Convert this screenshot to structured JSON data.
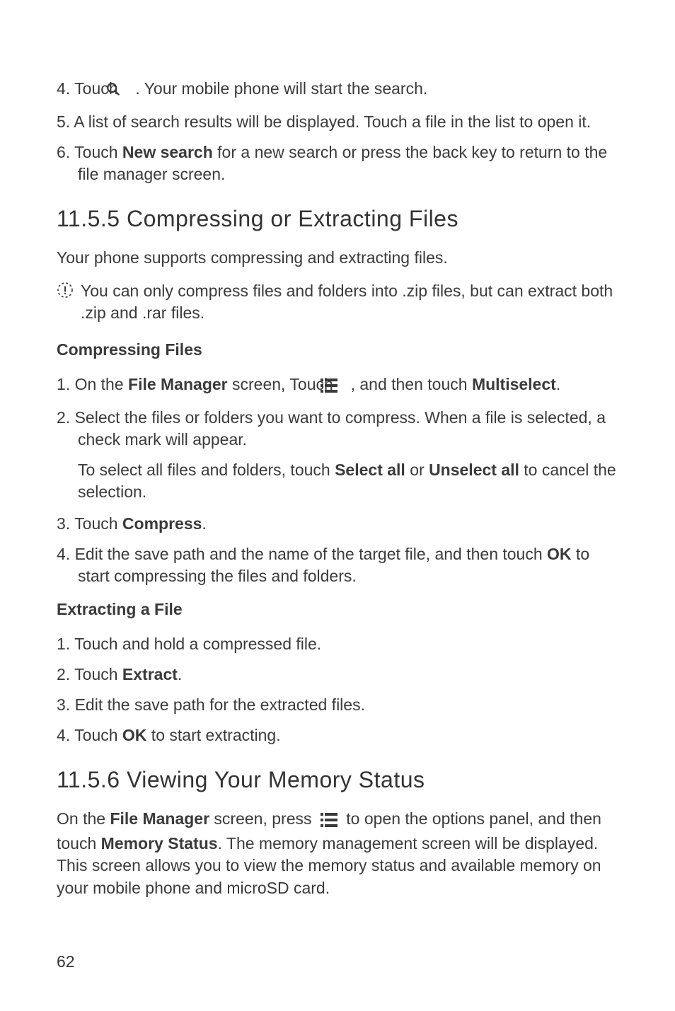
{
  "steps_top": {
    "s4_a": "4. Touch ",
    "s4_b": " . Your mobile phone will start the search.",
    "s5": "5. A list of search results will be displayed. Touch a file in the list to open it.",
    "s6_a": "6. Touch ",
    "s6_bold": "New search",
    "s6_b": " for a new search or press the back key to return to the file manager screen."
  },
  "section1": {
    "heading": "11.5.5  Compressing or Extracting Files",
    "intro": "Your phone supports compressing and extracting files.",
    "note": "You can only compress files and folders into .zip files, but can extract both .zip and .rar files."
  },
  "compressing": {
    "heading": "Compressing Files",
    "s1_a": "1. On the ",
    "s1_bold1": "File Manager",
    "s1_b": " screen, Touch ",
    "s1_c": " , and then touch ",
    "s1_bold2": "Multiselect",
    "s1_d": ".",
    "s2": "2. Select the files or folders you want to compress. When a file is selected, a check mark will appear.",
    "s2_tip_a": "To select all files and folders, touch ",
    "s2_tip_bold1": "Select all",
    "s2_tip_b": " or ",
    "s2_tip_bold2": "Unselect all",
    "s2_tip_c": " to cancel the selection.",
    "s3_a": "3. Touch ",
    "s3_bold": "Compress",
    "s3_b": ".",
    "s4_a": "4. Edit the save path and the name of the target file, and then touch ",
    "s4_bold": "OK",
    "s4_b": " to start compressing the files and folders."
  },
  "extracting": {
    "heading": "Extracting a File",
    "s1": "1. Touch and hold a compressed file.",
    "s2_a": "2. Touch ",
    "s2_bold": "Extract",
    "s2_b": ".",
    "s3": "3. Edit the save path for the extracted files.",
    "s4_a": "4. Touch ",
    "s4_bold": "OK",
    "s4_b": " to start extracting."
  },
  "section2": {
    "heading": "11.5.6  Viewing Your Memory Status",
    "p_a": "On the ",
    "p_bold1": "File Manager",
    "p_b": " screen, press ",
    "p_c": " to open the options panel, and then touch ",
    "p_bold2": "Memory Status",
    "p_d": ". The memory management screen will be displayed. This screen allows you to view the memory status and available memory on your mobile phone and microSD card."
  },
  "page_number": "62",
  "icons": {
    "search": "search-icon",
    "menu": "menu-icon",
    "note": "note-icon"
  }
}
